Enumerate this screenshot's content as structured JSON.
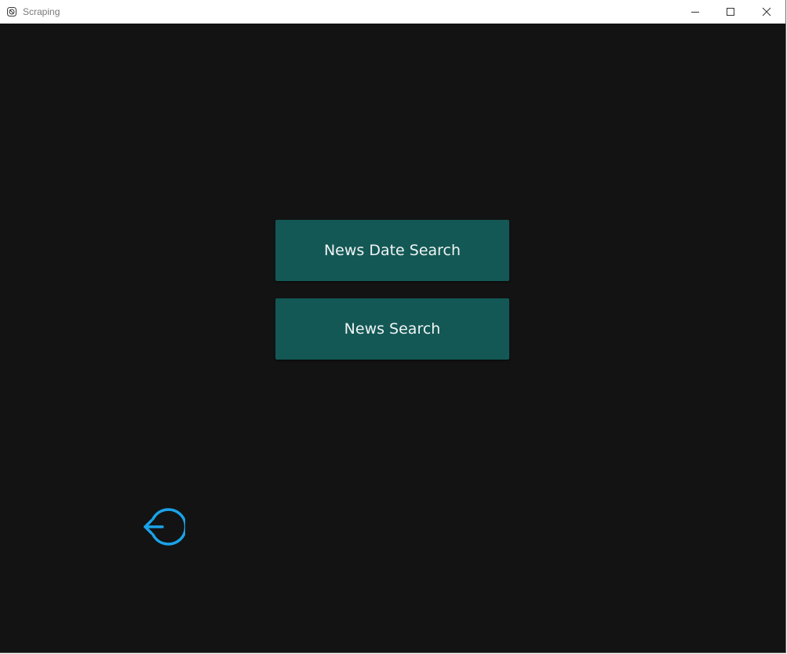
{
  "window": {
    "title": "Scraping"
  },
  "main": {
    "buttons": [
      {
        "label": "News Date Search"
      },
      {
        "label": "News Search"
      }
    ],
    "exit_icon": "logout-arrow-icon"
  },
  "colors": {
    "background": "#131314",
    "button": "#135855",
    "button_text": "#f0f4f4",
    "accent": "#1aa3e8"
  }
}
